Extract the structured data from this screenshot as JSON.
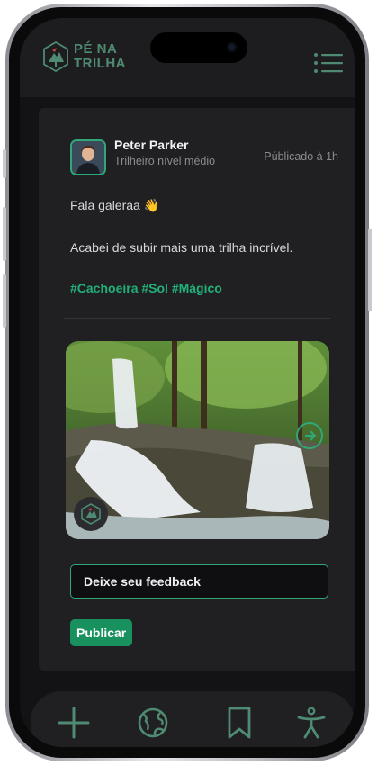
{
  "app": {
    "logo_line1": "PÉ NA",
    "logo_line2": "TRILHA",
    "accent": "#2fa779",
    "brand_color": "#4f8a72"
  },
  "header": {
    "menu_icon": "hamburger-menu-icon"
  },
  "post": {
    "author_name": "Peter Parker",
    "author_level": "Trilheiro nível médio",
    "posted_at": "Públicado à 1h",
    "greeting": "Fala galeraa 👋",
    "body": "Acabei de subir mais uma trilha incrível.",
    "hashtags": "#Cachoeira #Sol #Mágico",
    "image_icons": [
      "map-pin-icon",
      "next-arrow-icon"
    ]
  },
  "feedback": {
    "placeholder": "Deixe seu feedback",
    "publish_label": "Publicar"
  },
  "tabbar": {
    "items": [
      "add-icon",
      "globe-icon",
      "bookmark-icon",
      "accessibility-icon"
    ],
    "icon_color": "#4f8a72"
  }
}
